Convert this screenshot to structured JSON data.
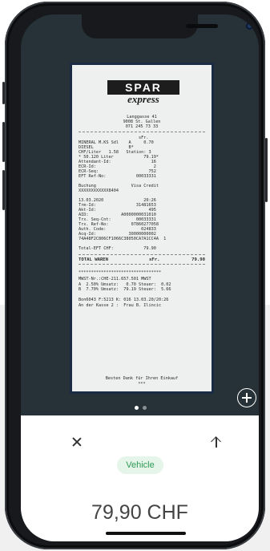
{
  "receipt": {
    "logo": {
      "brand": "SPAR",
      "subbrand": "express"
    },
    "header": [
      "Langgasse 41",
      "9008 St. Gallen",
      "071 245 73 33"
    ],
    "lines": [
      "                        sFr.",
      "MINERAL M.KS Sdl    A     0.70",
      "DIESEL              B*",
      "CHF/Liter   1.58   Station: 3",
      "* 50.120 Liter            79.19*",
      "Attendant-Id:                16",
      "ECR-Id:                       2",
      "ECR-Seq:                    752",
      "EFT Ref-No:            00033331",
      "",
      "Buchung              Visa Credit",
      "XXXXXXXXXXXX8404",
      "",
      "13.03.2020                20:26",
      "Trm-Id:                31481653",
      "Akt-Id:                     495",
      "AID:             A0000000031010",
      "Trx. Seq-Cnt:          00033331",
      "Trx. Ref-No:         07860277058",
      "Auth. Code:              024833",
      "Acq-Id:             30000000002",
      "74A48F2C806CF1066C38050CA7A1CC4A  1",
      "",
      "Total-EFT CHF:            79.90"
    ],
    "total_label": "TOTAL WAREN",
    "total_currency": "sFr.",
    "total_value": "79.90",
    "stars": "*********************************",
    "tax_lines": [
      "MWST-Nr.:CHE-211.657.501 MWST",
      "A  2.50% Umsatz:   0.70 Steuer:  0.02",
      "B  7.70% Umsatz:  79.19 Steuer:  5.66",
      "",
      "Bon6043 F:5213 K: 016 13.03.20/20:26",
      "An der Kasse 2 :  Frau B. Ilincic"
    ],
    "footer": [
      "Besten Dank für Ihren Einkauf",
      "***"
    ]
  },
  "pager": {
    "count": 2,
    "active": 0
  },
  "actions": {
    "add_icon": "plus-circle-icon",
    "close_icon": "close-icon",
    "share_icon": "arrow-up-icon"
  },
  "tag": {
    "label": "Vehicle",
    "color": "#2e9a52"
  },
  "amount": "79,90 CHF"
}
